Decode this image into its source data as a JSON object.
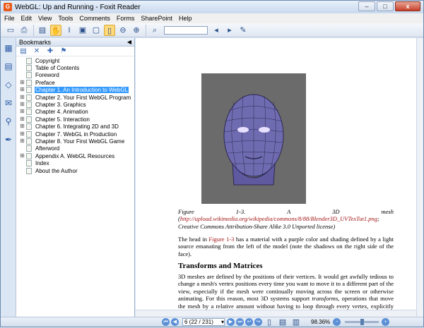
{
  "window": {
    "title": "WebGL: Up and Running - Foxit Reader",
    "minimize": "–",
    "maximize": "□",
    "close": "x"
  },
  "menu": [
    "File",
    "Edit",
    "View",
    "Tools",
    "Comments",
    "Forms",
    "SharePoint",
    "Help"
  ],
  "toolbar": {
    "icons": [
      "open-icon",
      "print-icon",
      "page-layout-icon",
      "hand-tool-icon",
      "select-text-icon",
      "snapshot-icon",
      "fit-page-icon",
      "zoom-out-icon",
      "zoom-in-icon",
      "find-icon",
      "search-field",
      "previous-view-icon",
      "next-view-icon",
      "comment-icon"
    ],
    "search_placeholder": ""
  },
  "panel": {
    "title": "Bookmarks",
    "bookmarks": [
      {
        "label": "Copyright",
        "expandable": false,
        "selected": false
      },
      {
        "label": "Table of Contents",
        "expandable": false,
        "selected": false
      },
      {
        "label": "Foreword",
        "expandable": false,
        "selected": false
      },
      {
        "label": "Preface",
        "expandable": true,
        "selected": false
      },
      {
        "label": "Chapter 1. An Introduction to WebGL",
        "expandable": true,
        "selected": true
      },
      {
        "label": "Chapter 2. Your First WebGL Program",
        "expandable": true,
        "selected": false
      },
      {
        "label": "Chapter 3. Graphics",
        "expandable": true,
        "selected": false
      },
      {
        "label": "Chapter 4. Animation",
        "expandable": true,
        "selected": false
      },
      {
        "label": "Chapter 5. Interaction",
        "expandable": true,
        "selected": false
      },
      {
        "label": "Chapter 6. Integrating 2D and 3D",
        "expandable": true,
        "selected": false
      },
      {
        "label": "Chapter 7. WebGL in Production",
        "expandable": true,
        "selected": false
      },
      {
        "label": "Chapter 8. Your First WebGL Game",
        "expandable": true,
        "selected": false
      },
      {
        "label": "Afterword",
        "expandable": false,
        "selected": false
      },
      {
        "label": "Appendix A. WebGL Resources",
        "expandable": true,
        "selected": false
      },
      {
        "label": "Index",
        "expandable": false,
        "selected": false
      },
      {
        "label": "About the Author",
        "expandable": false,
        "selected": false
      }
    ]
  },
  "document": {
    "caption_prefix": "Figure 1-3. A 3D mesh (",
    "caption_link": "http://upload.wikimedia.org/wikipedia/commons/8/88/Blender3D_UVTexTut1.png",
    "caption_suffix": "; Creative Commons Attribution-Share Alike 3.0 Unported license)",
    "para1_prefix": "The head in ",
    "para1_link": "Figure 1-3",
    "para1_suffix": " has a material with a purple color and shading defined by a light source emanating from the left of the model (note the shadows on the right side of the face).",
    "heading": "Transforms and Matrices",
    "para2_a": "3D meshes are defined by the positions of their vertices. It would get awfully tedious to change a mesh's vertex positions every time you want to move it to a different part of the view, especially if the mesh were continually moving across the screen or otherwise animating. For this reason, most 3D systems support ",
    "para2_em": "transforms",
    "para2_b": ", operations that move the mesh by a relative amount without having to loop through every vertex, explicitly changing its position. Transforms allow a rendered mesh to be scaled, rotated, and"
  },
  "status": {
    "page": "6 (22 / 231)",
    "zoom": "98.36%",
    "zoom_level": 0.5
  }
}
